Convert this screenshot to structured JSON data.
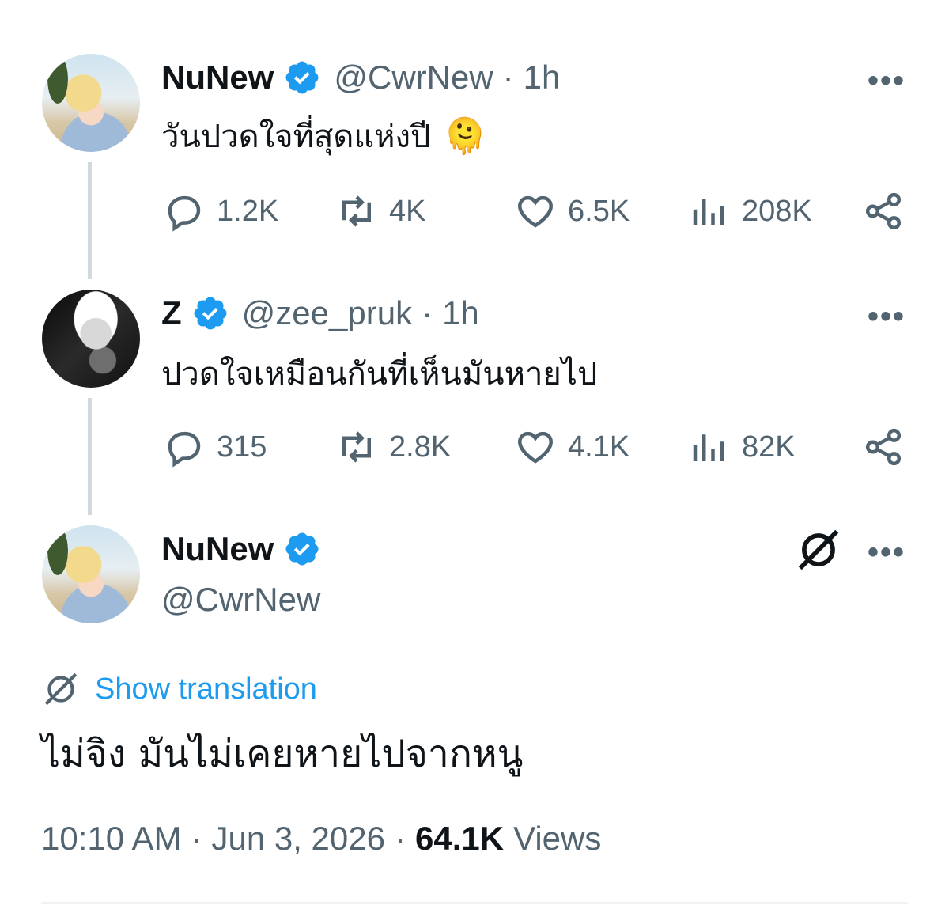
{
  "tweets": [
    {
      "name": "NuNew",
      "handle": "@CwrNew",
      "time": "1h",
      "text": "วันปวดใจที่สุดแห่งปี",
      "emoji": "🫠",
      "stats": {
        "replies": "1.2K",
        "reposts": "4K",
        "likes": "6.5K",
        "views": "208K"
      }
    },
    {
      "name": "Z",
      "handle": "@zee_pruk",
      "time": "1h",
      "text": "ปวดใจเหมือนกันที่เห็นมันหายไป",
      "stats": {
        "replies": "315",
        "reposts": "2.8K",
        "likes": "4.1K",
        "views": "82K"
      }
    }
  ],
  "main_tweet": {
    "name": "NuNew",
    "handle": "@CwrNew",
    "translate_label": "Show translation",
    "text": "ไม่จิง มันไม่เคยหายไปจากหนู",
    "time": "10:10 AM",
    "date": "Jun 3, 2026",
    "views_count": "64.1K",
    "views_label": "Views"
  },
  "separator": "·",
  "more_label": "•••",
  "colors": {
    "verified": "#1d9bf0",
    "link": "#1d9bf0",
    "muted": "#536471",
    "text": "#0f1419"
  }
}
